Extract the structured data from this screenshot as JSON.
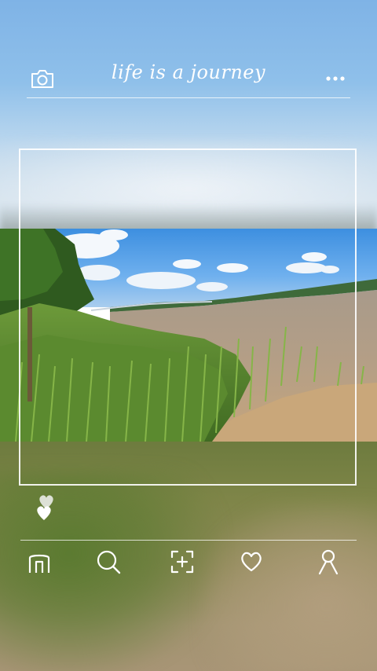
{
  "header": {
    "title": "life is a journey",
    "left_icon": "camera-icon",
    "right_icon": "more-dots-icon"
  },
  "photo": {
    "subject": "riverbank"
  },
  "like": {
    "icon": "heart-icon"
  },
  "nav": {
    "items": [
      {
        "icon": "home-icon"
      },
      {
        "icon": "search-icon"
      },
      {
        "icon": "add-photo-icon"
      },
      {
        "icon": "heart-outline-icon"
      },
      {
        "icon": "profile-icon"
      }
    ]
  },
  "colors": {
    "foreground": "#ffffff",
    "sky": "#7fb3e6",
    "ground": "#7e8548"
  }
}
